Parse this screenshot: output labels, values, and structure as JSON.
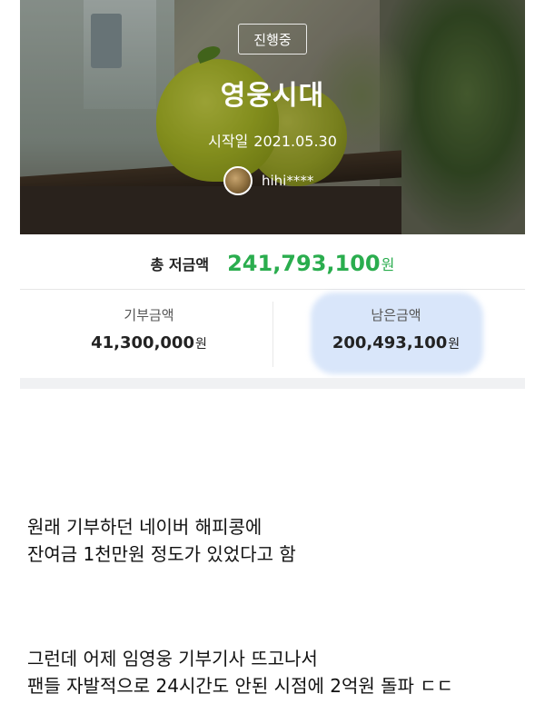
{
  "campaign": {
    "status_badge": "진행중",
    "title": "영웅시대",
    "start_label": "시작일",
    "start_date": "2021.05.30",
    "user_name": "hihi****"
  },
  "totals": {
    "label": "총 저금액",
    "amount": "241,793,100",
    "unit": "원"
  },
  "donated": {
    "label": "기부금액",
    "amount": "41,300,000",
    "unit": "원"
  },
  "remaining": {
    "label": "남은금액",
    "amount": "200,493,100",
    "unit": "원"
  },
  "post_text": {
    "line1": "원래 기부하던 네이버 해피콩에",
    "line2": "잔여금 1천만원 정도가 있었다고 함",
    "line3": "그런데 어제 임영웅 기부기사 뜨고나서",
    "line4": "팬들 자발적으로 24시간도 안된 시점에 2억원 돌파 ㄷㄷ"
  },
  "colors": {
    "accent_green": "#2aad4e",
    "highlight_blue": "#aac8f5"
  }
}
